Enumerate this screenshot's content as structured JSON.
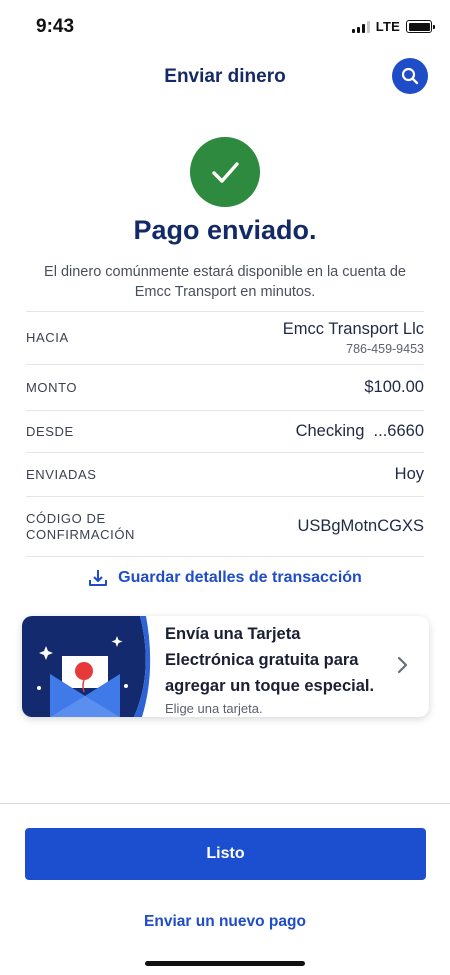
{
  "status_bar": {
    "time": "9:43",
    "network": "LTE"
  },
  "header": {
    "title": "Enviar dinero",
    "search_icon": "search-icon"
  },
  "success": {
    "icon": "checkmark-icon",
    "title": "Pago enviado.",
    "message": "El dinero comúnmente estará disponible en la cuenta de Emcc Transport en minutos."
  },
  "details": {
    "to": {
      "label": "HACIA",
      "value": "Emcc Transport Llc",
      "sub": "786-459-9453"
    },
    "amount": {
      "label": "MONTO",
      "value": "$100.00"
    },
    "from": {
      "label": "DESDE",
      "value": "Checking  ...6660"
    },
    "sent": {
      "label": "ENVIADAS",
      "value": "Hoy"
    },
    "confirmation": {
      "label": "CÓDIGO DE CONFIRMACIÓN",
      "value": "USBgMotnCGXS"
    }
  },
  "save_details": {
    "label": "Guardar detalles de transacción",
    "icon": "download-icon"
  },
  "promo": {
    "title": "Envía una Tarjeta Electrónica gratuita para agregar un toque especial.",
    "subtitle": "Elige una tarjeta.",
    "icon": "envelope-balloon-icon"
  },
  "actions": {
    "done": "Listo",
    "new_payment": "Enviar un nuevo pago"
  },
  "colors": {
    "primary": "#1c4fd0",
    "navy": "#142a66",
    "success": "#2d8a3f"
  }
}
